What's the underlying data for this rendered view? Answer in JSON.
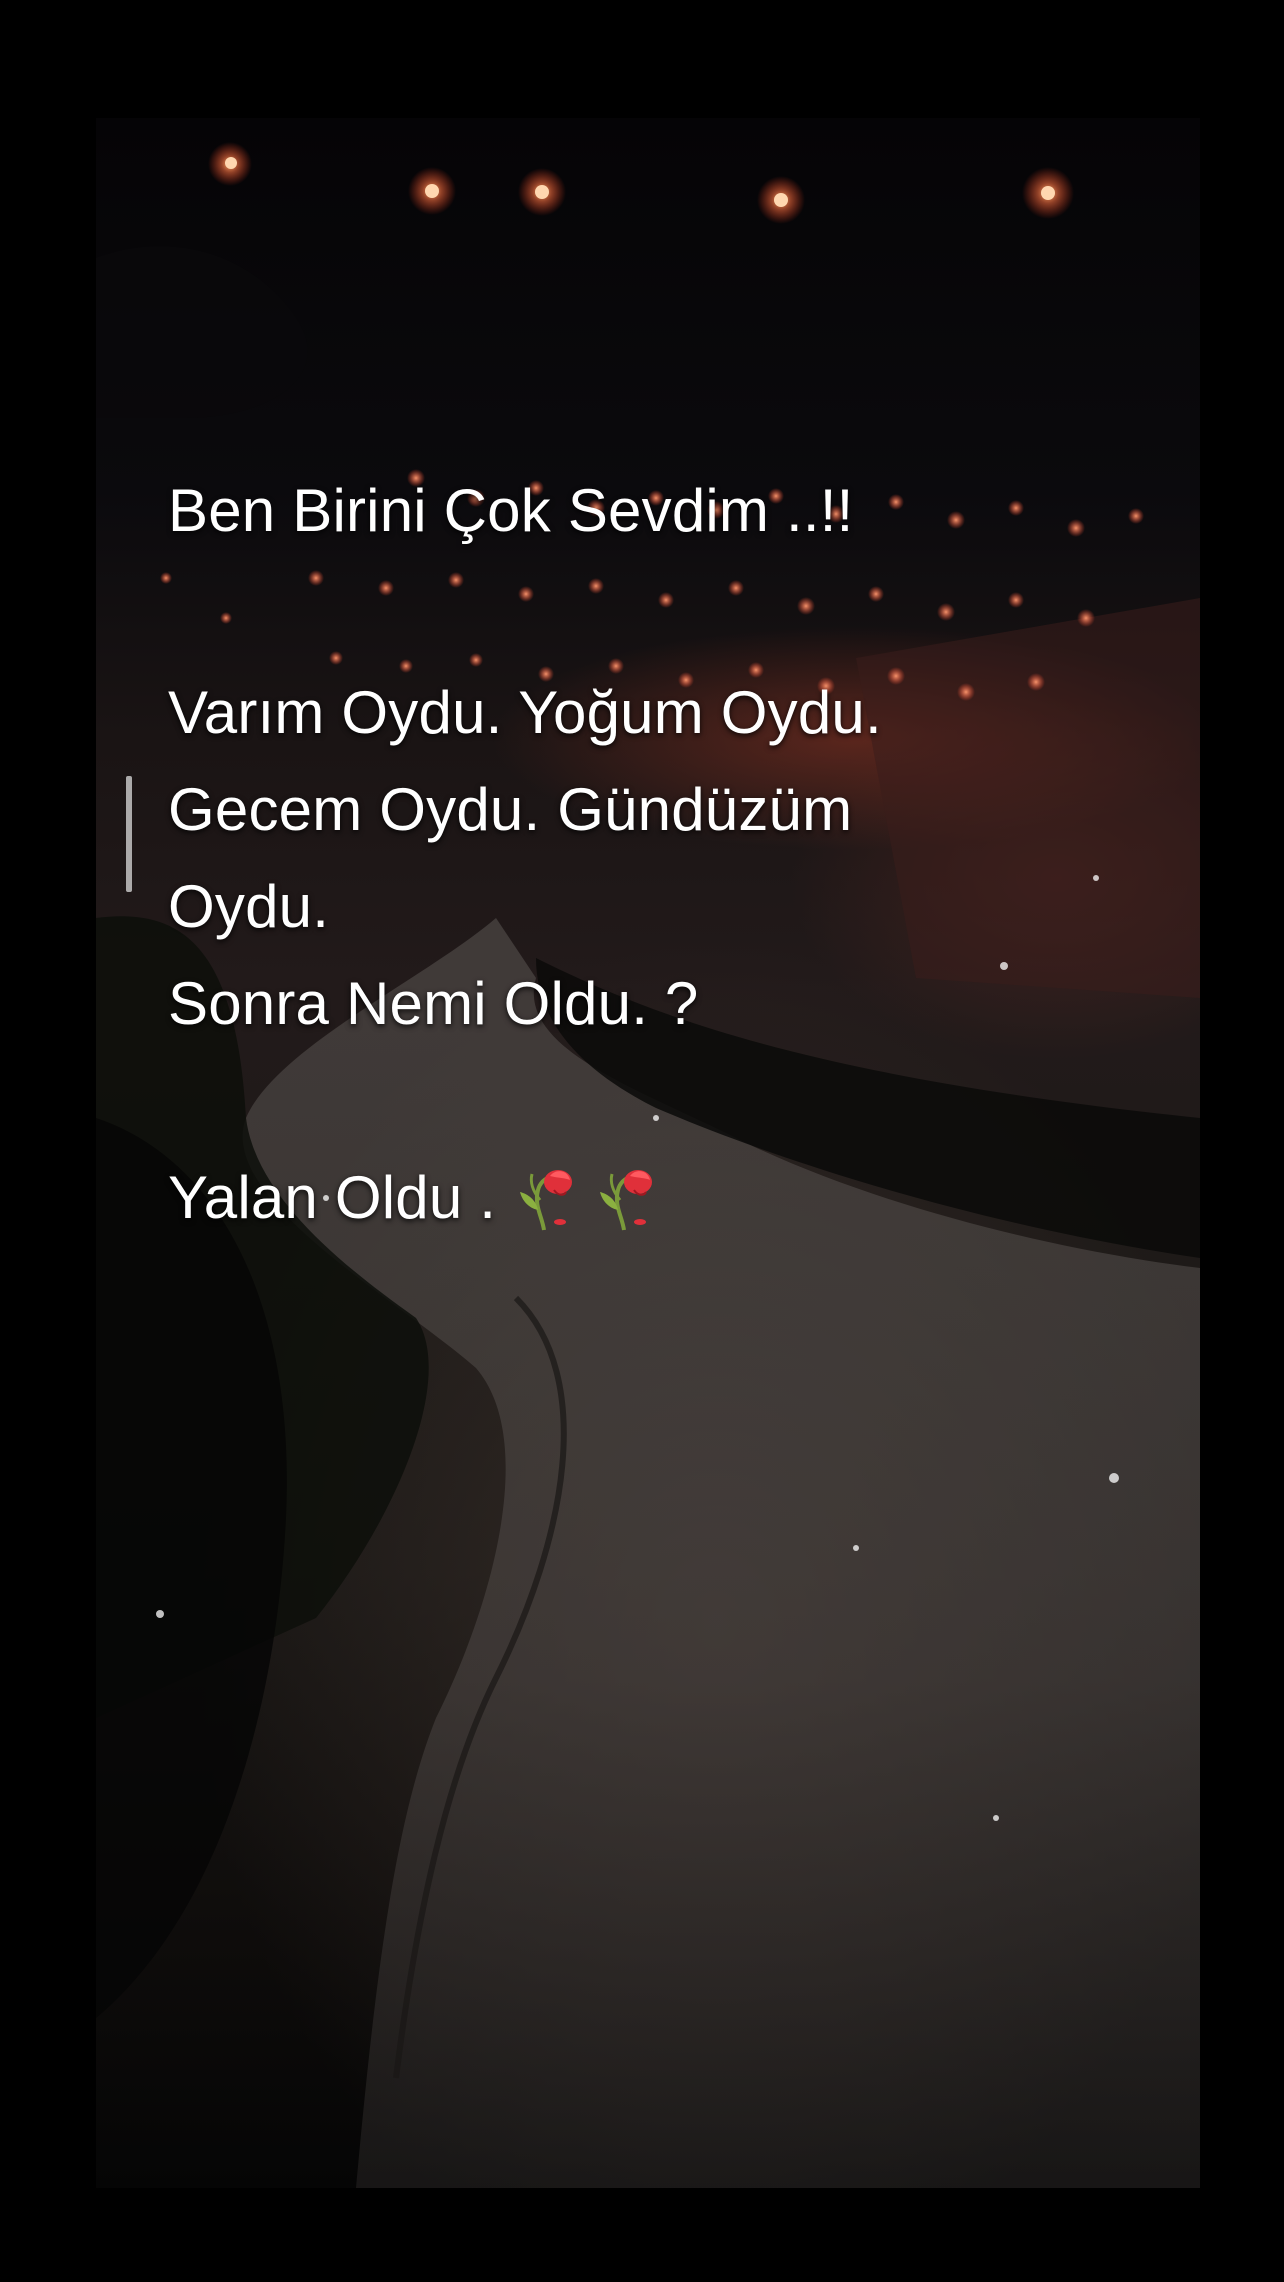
{
  "caption": {
    "line1": "Ben Birini Çok Sevdim ..!!",
    "line2": "Varım Oydu. Yoğum Oydu.",
    "line3": "Gecem Oydu. Gündüzüm",
    "line4": "Oydu.",
    "line5": "Sonra Nemi Oldu. ?",
    "line6": "Yalan Oldu ."
  },
  "icons": {
    "rose1": "wilted-rose-icon",
    "rose2": "wilted-rose-icon"
  },
  "colors": {
    "text": "#ffffff",
    "rose_petal": "#e0303a",
    "rose_stem": "#7a9a3a",
    "light_bulbs": "#ff8a55"
  }
}
